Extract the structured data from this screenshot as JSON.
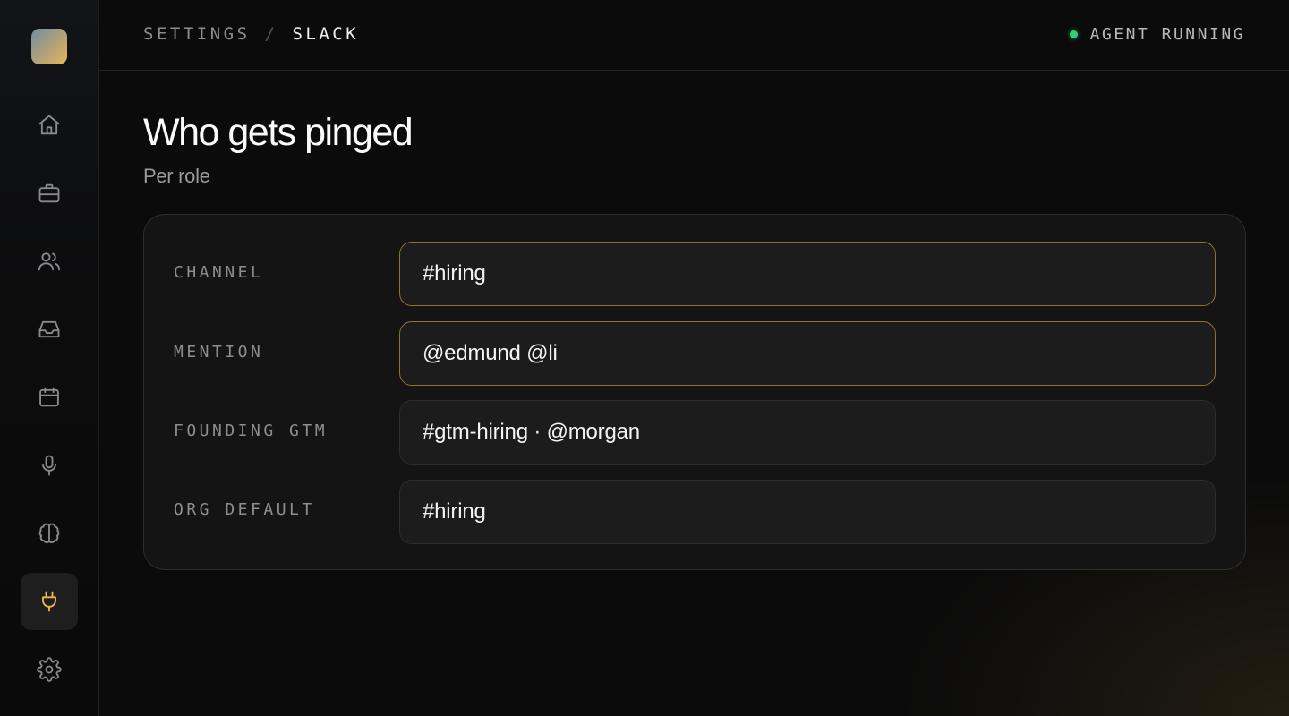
{
  "header": {
    "breadcrumb_parent": "SETTINGS",
    "breadcrumb_separator": "/",
    "breadcrumb_current": "SLACK",
    "status_text": "AGENT RUNNING",
    "status_color": "#33d07a"
  },
  "sidebar": {
    "accent_color": "#e6b84d",
    "items": [
      {
        "icon": "home-icon",
        "active": false
      },
      {
        "icon": "briefcase-icon",
        "active": false
      },
      {
        "icon": "users-icon",
        "active": false
      },
      {
        "icon": "inbox-icon",
        "active": false
      },
      {
        "icon": "calendar-icon",
        "active": false
      },
      {
        "icon": "microphone-icon",
        "active": false
      },
      {
        "icon": "brain-icon",
        "active": false
      },
      {
        "icon": "plug-icon",
        "active": true
      },
      {
        "icon": "gear-icon",
        "active": false
      }
    ]
  },
  "main": {
    "title": "Who gets pinged",
    "subtitle": "Per role",
    "rows": [
      {
        "label": "CHANNEL",
        "value": "#hiring",
        "focused": true
      },
      {
        "label": "MENTION",
        "value": "@edmund @li",
        "focused": true
      },
      {
        "label": "FOUNDING GTM",
        "value": "#gtm-hiring · @morgan",
        "focused": false
      },
      {
        "label": "ORG DEFAULT",
        "value": "#hiring",
        "focused": false
      }
    ]
  }
}
